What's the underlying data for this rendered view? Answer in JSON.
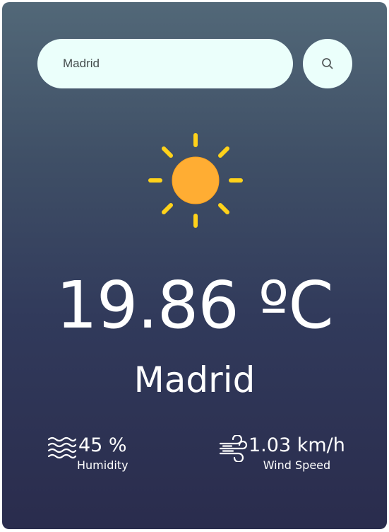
{
  "search": {
    "value": "Madrid",
    "icon": "search-icon"
  },
  "weather": {
    "icon": "sun-icon",
    "temperature": "19.86 ºC",
    "city": "Madrid"
  },
  "humidity": {
    "value": "45 %",
    "label": "Humidity",
    "icon": "humidity-waves-icon"
  },
  "wind": {
    "value": "1.03 km/h",
    "label": "Wind Speed",
    "icon": "wind-icon"
  },
  "colors": {
    "card_top": "#526878",
    "card_bottom": "#2a2c4d",
    "input_bg": "#ebfffb",
    "sun_rays": "#ffd21a",
    "sun_body": "#ffad33"
  }
}
